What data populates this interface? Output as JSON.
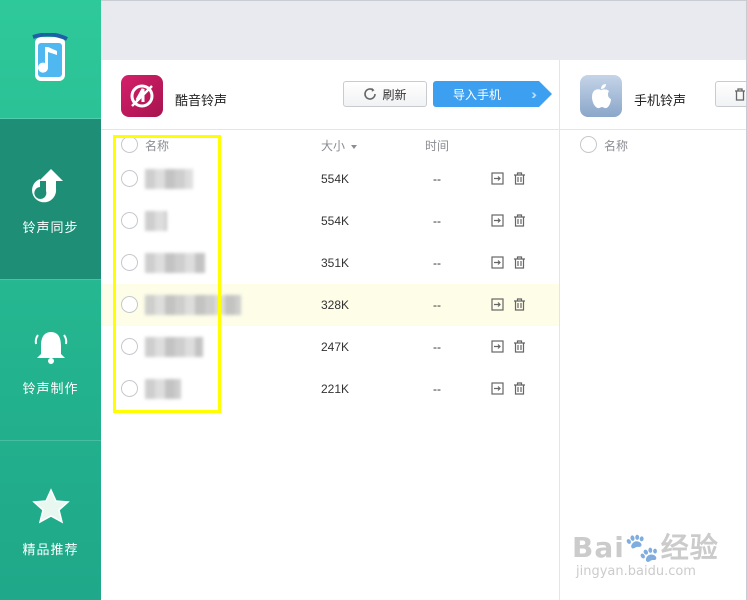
{
  "sidebar": {
    "logo_icon": "music-phone-icon",
    "items": [
      {
        "label": "铃声同步",
        "icon": "sync-arrow-icon",
        "active": true
      },
      {
        "label": "铃声制作",
        "icon": "bell-icon",
        "active": false
      },
      {
        "label": "精品推荐",
        "icon": "star-icon",
        "active": false
      }
    ],
    "colors": {
      "gradient_top": "#2ec99a",
      "gradient_bottom": "#1fa889",
      "active_bg": "#1e8f76"
    }
  },
  "left_panel": {
    "title": "酷音铃声",
    "refresh_label": "刷新",
    "import_label": "导入手机",
    "columns": {
      "name": "名称",
      "size": "大小",
      "time": "时间"
    },
    "rows": [
      {
        "size": "554K",
        "time": "--",
        "highlighted": false
      },
      {
        "size": "554K",
        "time": "--",
        "highlighted": false
      },
      {
        "size": "351K",
        "time": "--",
        "highlighted": false
      },
      {
        "size": "328K",
        "time": "--",
        "highlighted": true
      },
      {
        "size": "247K",
        "time": "--",
        "highlighted": false
      },
      {
        "size": "221K",
        "time": "--",
        "highlighted": false
      }
    ]
  },
  "right_panel": {
    "title": "手机铃声",
    "columns": {
      "name": "名称"
    }
  },
  "watermark": {
    "brand": "Bai🐾经验",
    "url": "jingyan.baidu.com"
  },
  "colors": {
    "accent_blue": "#3c9ff0",
    "highlight_row": "#fdfde8",
    "annotation_yellow": "#ffff00"
  }
}
